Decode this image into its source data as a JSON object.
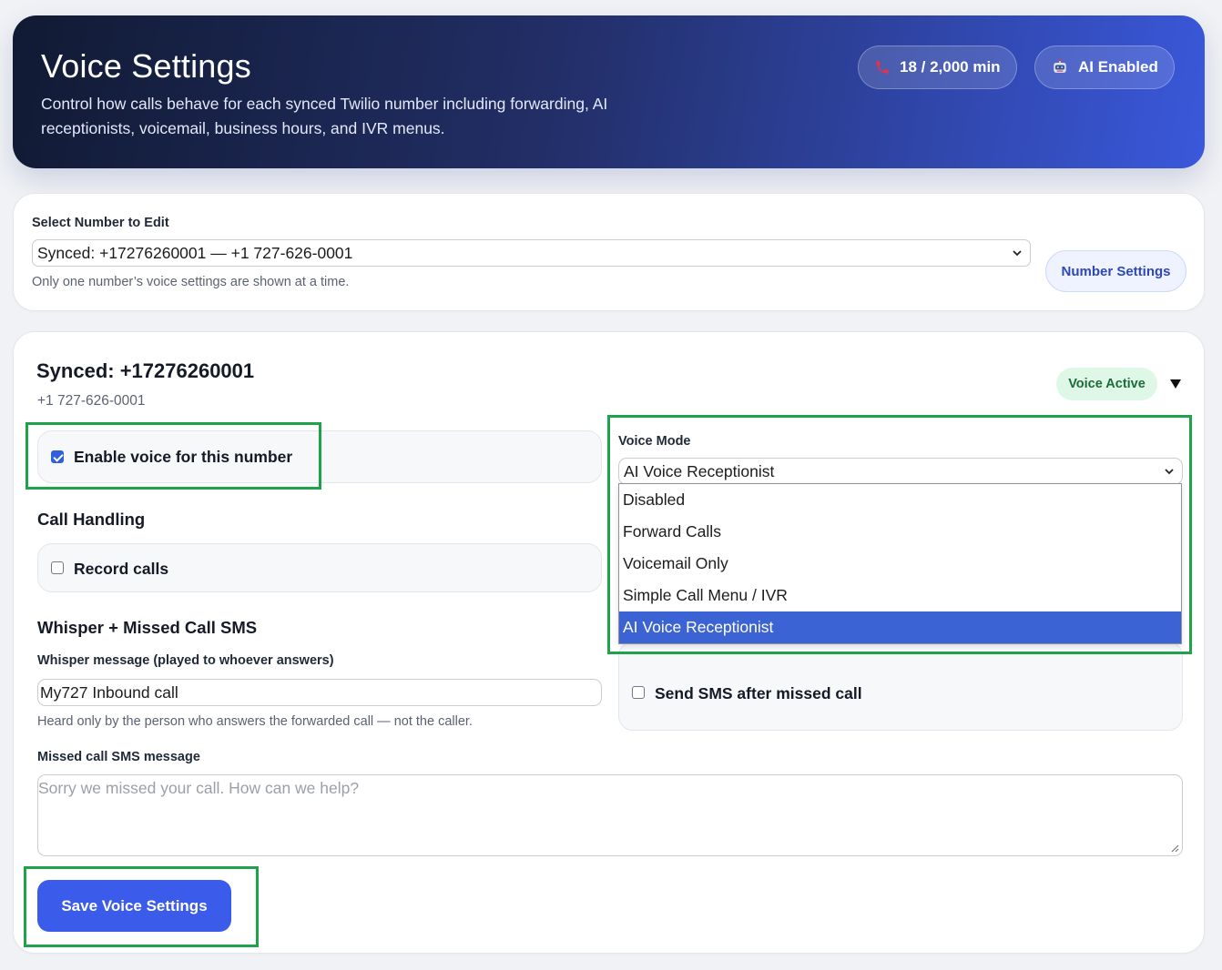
{
  "hero": {
    "title": "Voice Settings",
    "subtitle": "Control how calls behave for each synced Twilio number including forwarding, AI receptionists, voicemail, business hours, and IVR menus.",
    "minutes_badge": "18 / 2,000 min",
    "ai_badge": "AI Enabled",
    "minutes_icon": "phone-icon",
    "ai_icon": "robot-icon"
  },
  "selector": {
    "label": "Select Number to Edit",
    "selected": "Synced: +17276260001 — +1 727-626-0001",
    "hint": "Only one number’s voice settings are shown at a time.",
    "number_settings_label": "Number Settings"
  },
  "number": {
    "title": "Synced: +17276260001",
    "formatted": "+1 727-626-0001",
    "status_badge": "Voice Active"
  },
  "enable_voice": {
    "label": "Enable voice for this number",
    "checked": true
  },
  "call_handling": {
    "title": "Call Handling",
    "record_label": "Record calls",
    "record_checked": false
  },
  "voice_mode": {
    "label": "Voice Mode",
    "selected": "AI Voice Receptionist",
    "options": [
      "Disabled",
      "Forward Calls",
      "Voicemail Only",
      "Simple Call Menu / IVR",
      "AI Voice Receptionist"
    ]
  },
  "whisper": {
    "title": "Whisper + Missed Call SMS",
    "message_label": "Whisper message (played to whoever answers)",
    "message_value": "My727 Inbound call",
    "message_hint": "Heard only by the person who answers the forwarded call — not the caller.",
    "sms_toggle_label": "Send SMS after missed call",
    "sms_checked": false,
    "sms_label": "Missed call SMS message",
    "sms_placeholder": "Sorry we missed your call. How can we help?"
  },
  "actions": {
    "save_label": "Save Voice Settings"
  },
  "colors": {
    "accent": "#3b5bea",
    "highlight": "#1fa34a",
    "active_badge": "#def7e7"
  }
}
